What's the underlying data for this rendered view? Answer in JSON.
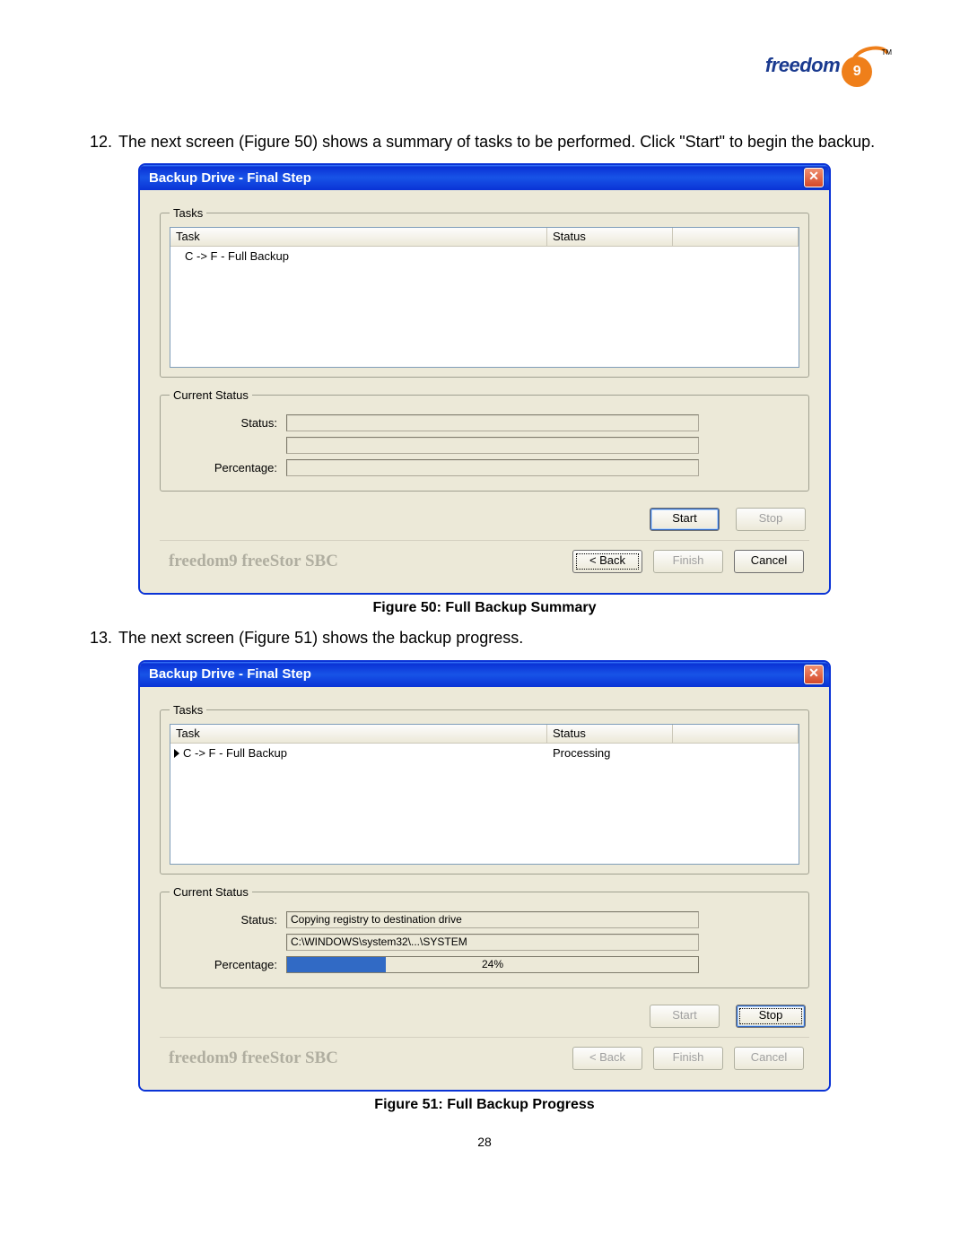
{
  "logo": {
    "text": "freedom",
    "nine": "9",
    "tm": "TM"
  },
  "step12": {
    "num": "12.",
    "text": "The next screen (Figure 50) shows a summary of tasks to be performed. Click \"Start\" to begin the backup."
  },
  "step13": {
    "num": "13.",
    "text": "The next screen (Figure 51) shows the backup progress."
  },
  "caption1": "Figure 50: Full Backup Summary",
  "caption2": "Figure 51: Full Backup Progress",
  "window1": {
    "title": "Backup Drive - Final Step",
    "tasks_legend": "Tasks",
    "col_task": "Task",
    "col_status": "Status",
    "row_task": "C -> F - Full Backup",
    "row_status": "",
    "current_legend": "Current Status",
    "lbl_status": "Status:",
    "lbl_percentage": "Percentage:",
    "status_val": "",
    "path_val": "",
    "percentage_val": "",
    "btn_start": "Start",
    "btn_stop": "Stop",
    "brand": "freedom9 freeStor SBC",
    "btn_back": "< Back",
    "btn_finish": "Finish",
    "btn_cancel": "Cancel"
  },
  "window2": {
    "title": "Backup Drive - Final Step",
    "tasks_legend": "Tasks",
    "col_task": "Task",
    "col_status": "Status",
    "row_task": "C -> F - Full Backup",
    "row_status": "Processing",
    "current_legend": "Current Status",
    "lbl_status": "Status:",
    "lbl_percentage": "Percentage:",
    "status_val": "Copying registry to destination drive",
    "path_val": "C:\\WINDOWS\\system32\\...\\SYSTEM",
    "percentage_val": "24%",
    "percentage_num": 24,
    "btn_start": "Start",
    "btn_stop": "Stop",
    "brand": "freedom9 freeStor SBC",
    "btn_back": "< Back",
    "btn_finish": "Finish",
    "btn_cancel": "Cancel"
  },
  "page_num": "28"
}
